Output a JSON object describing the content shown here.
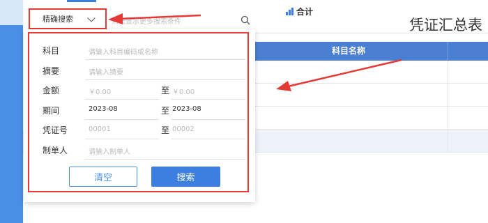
{
  "toolbar": {
    "search_mode": "精确搜索",
    "hint": "点击显示更多搜索条件",
    "title": "凭证汇总表"
  },
  "table": {
    "column_header": "科目名称",
    "total_label": "合计"
  },
  "search_panel": {
    "subject": {
      "label": "科目",
      "placeholder": "请输入科目编码或名称"
    },
    "summary": {
      "label": "摘要",
      "placeholder": "请输入摘要"
    },
    "amount": {
      "label": "金额",
      "from": "￥0.00",
      "to_label": "至",
      "to": "￥0.00"
    },
    "period": {
      "label": "期间",
      "from": "2023-08",
      "to_label": "至",
      "to": "2023-08"
    },
    "voucher_no": {
      "label": "凭证号",
      "from": "00001",
      "to_label": "至",
      "to": "00002"
    },
    "creator": {
      "label": "制单人",
      "placeholder": "请输入制单人"
    },
    "clear_button": "清空",
    "search_button": "搜索"
  },
  "colors": {
    "accent": "#3d7fe0",
    "highlight": "#e53935",
    "header_bg": "#4a7fd4"
  },
  "icons": [
    "chevron-down-icon",
    "search-icon",
    "bar-chart-icon"
  ]
}
